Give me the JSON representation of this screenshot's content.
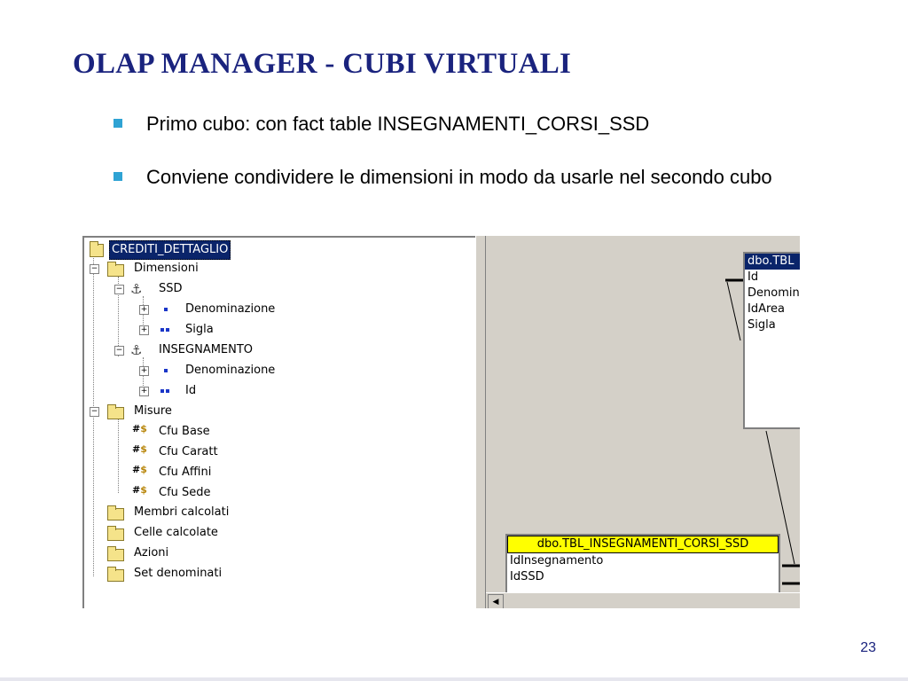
{
  "slide": {
    "title": "OLAP MANAGER - CUBI VIRTUALI",
    "bullets": [
      "Primo cubo: con fact table INSEGNAMENTI_CORSI_SSD",
      "Conviene condividere le dimensioni in modo da usarle nel secondo cubo"
    ],
    "page_number": "23",
    "bullet_color": "#2fa3d4",
    "title_color": "#1a237e"
  },
  "tree": {
    "cube": "CREDITI_DETTAGLIO",
    "dimensioni": "Dimensioni",
    "ssd": "SSD",
    "ssd_den": "Denominazione",
    "ssd_sigla": "Sigla",
    "insegnamento": "INSEGNAMENTO",
    "ins_den": "Denominazione",
    "ins_id": "Id",
    "misure": "Misure",
    "m1": "Cfu Base",
    "m2": "Cfu Caratt",
    "m3": "Cfu Affini",
    "m4": "Cfu Sede",
    "membri": "Membri calcolati",
    "celle": "Celle calcolate",
    "azioni": "Azioni",
    "set": "Set denominati"
  },
  "schema": {
    "table1": {
      "name": "dbo.TBL",
      "fields": [
        "Id",
        "Denomin",
        "IdArea",
        "Sigla"
      ]
    },
    "table2": {
      "name": "dbo.TBL_INSEGNAMENTI_CORSI_SSD",
      "fields": [
        "IdInsegnamento",
        "IdSSD"
      ]
    }
  }
}
